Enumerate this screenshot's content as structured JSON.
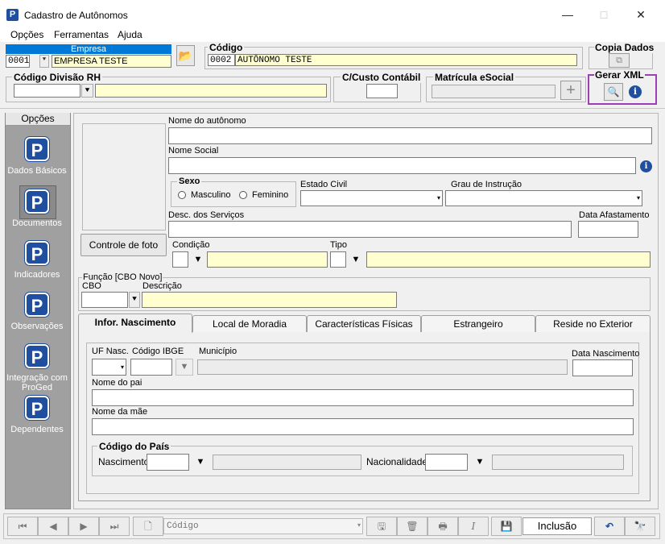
{
  "window": {
    "title": "Cadastro de Autônomos",
    "minimize": "—",
    "maximize": "□",
    "close": "✕"
  },
  "menu": [
    "Opções",
    "Ferramentas",
    "Ajuda"
  ],
  "empresa": {
    "label": "Empresa",
    "code": "0001",
    "name": "EMPRESA TESTE"
  },
  "codigo": {
    "label": "Código",
    "value": "0002",
    "name": "AUTÔNOMO TESTE"
  },
  "copia": {
    "label": "Copia Dados"
  },
  "divisao": {
    "label": "Código Divisão RH",
    "code": "",
    "desc": ""
  },
  "custo": {
    "label": "C/Custo Contábil",
    "value": ""
  },
  "matricula": {
    "label": "Matrícula eSocial",
    "value": ""
  },
  "xml": {
    "label": "Gerar XML"
  },
  "sidebar": {
    "header": "Opções",
    "items": [
      {
        "label": "Dados Básicos"
      },
      {
        "label": "Documentos"
      },
      {
        "label": "Indicadores"
      },
      {
        "label": "Observações"
      },
      {
        "label": "Integração com ProGed"
      },
      {
        "label": "Dependentes"
      }
    ]
  },
  "form": {
    "foto_button": "Controle de foto",
    "nome_label": "Nome do autônomo",
    "nome": "",
    "social_label": "Nome Social",
    "social": "",
    "sexo_label": "Sexo",
    "masculino": "Masculino",
    "feminino": "Feminino",
    "estado_label": "Estado Civil",
    "grau_label": "Grau de Instrução",
    "servicos_label": "Desc. dos Serviços",
    "afastamento_label": "Data Afastamento",
    "condicao_label": "Condição",
    "tipo_label": "Tipo",
    "funcao_label": "Função [CBO Novo]",
    "cbo_label": "CBO",
    "descricao_label": "Descrição"
  },
  "tabs": [
    "Infor. Nascimento",
    "Local de Moradia",
    "Características Físicas",
    "Estrangeiro",
    "Reside no Exterior"
  ],
  "nasc": {
    "uf_label": "UF Nasc.",
    "ibge_label": "Código IBGE",
    "municipio_label": "Município",
    "data_label": "Data Nascimento",
    "pai_label": "Nome do pai",
    "mae_label": "Nome da mãe",
    "pais_label": "Código do País",
    "nascimento_label": "Nascimento",
    "nacionalidade_label": "Nacionalidade"
  },
  "navbar": {
    "search_placeholder": "Código",
    "status": "Inclusão"
  }
}
